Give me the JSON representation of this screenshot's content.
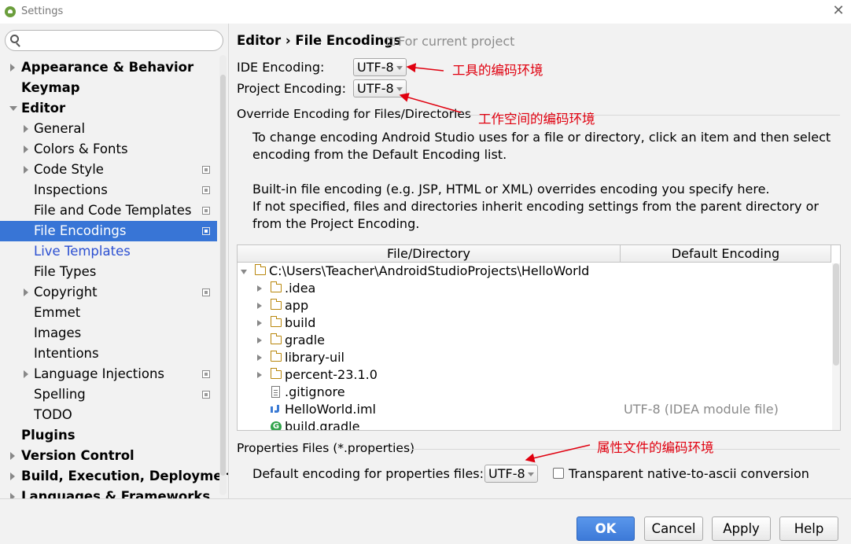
{
  "window": {
    "title": "Settings"
  },
  "search": {
    "placeholder": ""
  },
  "sidebar": {
    "items": [
      {
        "label": "Appearance & Behavior"
      },
      {
        "label": "Keymap"
      },
      {
        "label": "Editor"
      },
      {
        "label": "General"
      },
      {
        "label": "Colors & Fonts"
      },
      {
        "label": "Code Style"
      },
      {
        "label": "Inspections"
      },
      {
        "label": "File and Code Templates"
      },
      {
        "label": "File Encodings"
      },
      {
        "label": "Live Templates"
      },
      {
        "label": "File Types"
      },
      {
        "label": "Copyright"
      },
      {
        "label": "Emmet"
      },
      {
        "label": "Images"
      },
      {
        "label": "Intentions"
      },
      {
        "label": "Language Injections"
      },
      {
        "label": "Spelling"
      },
      {
        "label": "TODO"
      },
      {
        "label": "Plugins"
      },
      {
        "label": "Version Control"
      },
      {
        "label": "Build, Execution, Deployment"
      },
      {
        "label": "Languages & Frameworks"
      }
    ]
  },
  "header": {
    "breadcrumb": "Editor › File Encodings",
    "scope": "For current project"
  },
  "ide_encoding": {
    "label": "IDE Encoding:",
    "value": "UTF-8"
  },
  "project_encoding": {
    "label": "Project Encoding:",
    "value": "UTF-8"
  },
  "override_section": {
    "title": "Override Encoding for Files/Directories",
    "para1": "To change encoding Android Studio uses for a file or directory, click an item and then select encoding from the Default Encoding list.",
    "para2a": "Built-in file encoding (e.g. JSP, HTML or XML) overrides encoding you specify here.",
    "para2b": "If not specified, files and directories inherit encoding settings from the parent directory or from the Project Encoding."
  },
  "table": {
    "columns": [
      "File/Directory",
      "Default Encoding"
    ],
    "rows": [
      {
        "name": "C:\\Users\\Teacher\\AndroidStudioProjects\\HelloWorld",
        "encoding": ""
      },
      {
        "name": ".idea",
        "encoding": ""
      },
      {
        "name": "app",
        "encoding": ""
      },
      {
        "name": "build",
        "encoding": ""
      },
      {
        "name": "gradle",
        "encoding": ""
      },
      {
        "name": "library-uil",
        "encoding": ""
      },
      {
        "name": "percent-23.1.0",
        "encoding": ""
      },
      {
        "name": ".gitignore",
        "encoding": ""
      },
      {
        "name": "HelloWorld.iml",
        "encoding": "UTF-8 (IDEA module file)"
      },
      {
        "name": "build.gradle",
        "encoding": ""
      }
    ]
  },
  "properties": {
    "title": "Properties Files (*.properties)",
    "label": "Default encoding for properties files:",
    "value": "UTF-8",
    "checkbox_label": "Transparent native-to-ascii conversion"
  },
  "annotations": {
    "ide": "工具的编码环境",
    "project": "工作空间的编码环境",
    "properties": "属性文件的编码环境"
  },
  "buttons": {
    "ok": "OK",
    "cancel": "Cancel",
    "apply": "Apply",
    "help": "Help"
  },
  "colors": {
    "selection": "#3875d6",
    "annotation": "#e0000f",
    "link": "#2b4fd1"
  }
}
